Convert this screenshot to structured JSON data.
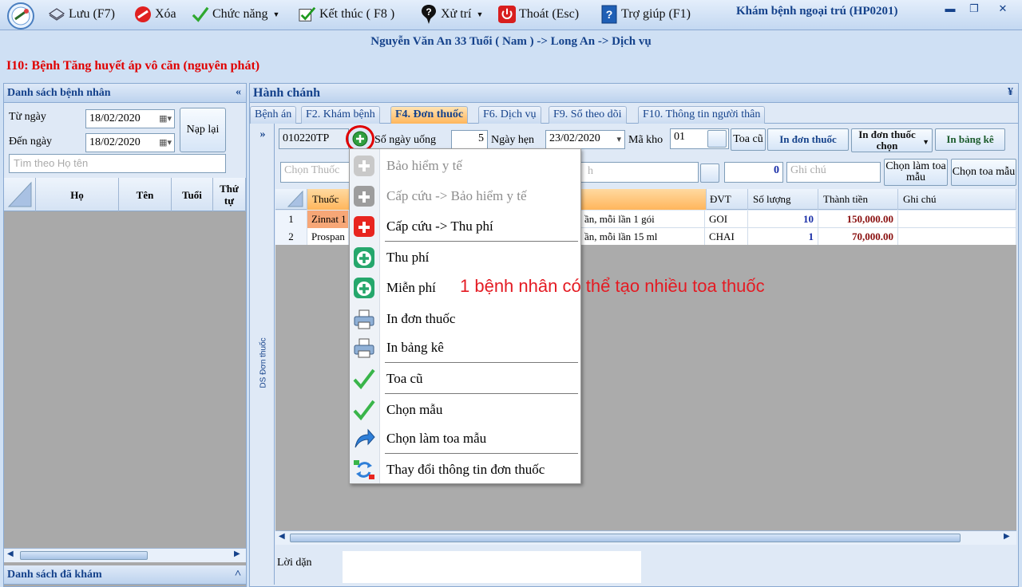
{
  "app_title": "Khám bệnh ngoại trú (HP0201)",
  "toolbar": [
    {
      "label": "Lưu (F7)",
      "icon": "save-icon"
    },
    {
      "label": "Xóa",
      "icon": "delete-icon"
    },
    {
      "label": "Chức năng",
      "icon": "check-icon"
    },
    {
      "label": "Kết thúc ( F8 )",
      "icon": "finish-icon"
    },
    {
      "label": "Xử trí",
      "icon": "question-icon"
    },
    {
      "label": "Thoát (Esc)",
      "icon": "power-icon"
    },
    {
      "label": "Trợ giúp (F1)",
      "icon": "help-icon"
    }
  ],
  "patient_line": "Nguyễn Văn An 33 Tuổi ( Nam ) -> Long An -> Dịch vụ",
  "diagnosis": "I10: Bệnh Tăng huyết áp vô căn (nguyên phát)",
  "left": {
    "title": "Danh sách bệnh nhân",
    "from_label": "Từ ngày",
    "from_value": "18/02/2020",
    "to_label": "Đến ngày",
    "to_value": "18/02/2020",
    "reload": "Nạp lại",
    "search_placeholder": "Tìm theo Họ tên",
    "columns": [
      "Họ",
      "Tên",
      "Tuổi",
      "Thứ tự"
    ],
    "footer": "Danh sách đã khám"
  },
  "right": {
    "title": "Hành chánh",
    "tabs": [
      "Bệnh án",
      "F2. Khám bệnh",
      "F4. Đơn thuốc",
      "F6. Dịch vụ",
      "F9. Sổ theo dõi",
      "F10. Thông tin người thân"
    ],
    "active_tab": 2,
    "side_label": "DS Đơn thuốc",
    "prescription_code": "010220TP",
    "days_label": "Số ngày uống",
    "days_value": "5",
    "appointment_label": "Ngày hẹn",
    "appointment_value": "23/02/2020",
    "warehouse_label": "Mã kho",
    "warehouse_value": "01",
    "old_btn": "Toa cũ",
    "print_rx": "In đơn thuốc",
    "print_rx_choose": "In đơn thuốc chọn",
    "print_bill": "In bảng kê",
    "choose_drug_placeholder": "Chọn Thuốc",
    "choose_drug_tail": "h",
    "qty_value": "0",
    "note_placeholder": "Ghi chú",
    "make_template": "Chọn làm toa mẫu",
    "choose_template": "Chọn toa mẫu",
    "grid_columns": [
      "Thuốc",
      "ĐVT",
      "Số lượng",
      "Thành tiền",
      "Ghi chú"
    ],
    "rows": [
      {
        "no": "1",
        "drug": "Zinnat 1",
        "usage": "ần, mỗi lần 1 gói",
        "unit": "GOI",
        "qty": "10",
        "amount": "150,000.00"
      },
      {
        "no": "2",
        "drug": "Prospan",
        "usage": "ần, mỗi lần 15 ml",
        "unit": "CHAI",
        "qty": "1",
        "amount": "70,000.00"
      }
    ],
    "advice_label": "Lời dặn"
  },
  "menu": [
    {
      "label": "Bảo hiểm y tế",
      "icon": "insurance-plus-icon",
      "disabled": true
    },
    {
      "label": "Cấp cứu -> Bảo hiểm y tế",
      "icon": "emergency-insurance-icon",
      "disabled": true
    },
    {
      "label": "Cấp cứu -> Thu phí",
      "icon": "emergency-fee-icon",
      "disabled": false
    },
    {
      "label": "Thu phí",
      "icon": "fee-plus-icon",
      "disabled": false
    },
    {
      "label": "Miễn phí",
      "icon": "free-plus-icon",
      "disabled": false
    },
    {
      "label": "In đơn thuốc",
      "icon": "printer-icon",
      "disabled": false
    },
    {
      "label": "In bảng kê",
      "icon": "printer-icon",
      "disabled": false
    },
    {
      "label": "Toa cũ",
      "icon": "green-check-icon",
      "disabled": false
    },
    {
      "label": "Chọn mẫu",
      "icon": "green-check-icon",
      "disabled": false
    },
    {
      "label": "Chọn làm toa mẫu",
      "icon": "blue-arrow-icon",
      "disabled": false
    },
    {
      "label": "Thay đổi thông tin đơn thuốc",
      "icon": "swap-icon",
      "disabled": false
    }
  ],
  "annotation": "1 bệnh nhân có thể tạo nhiều toa thuốc",
  "colors": {
    "header_text": "#15428b",
    "diagnosis": "#e00000",
    "annotation": "#e41b23",
    "active_tab": "#ffb65c"
  }
}
